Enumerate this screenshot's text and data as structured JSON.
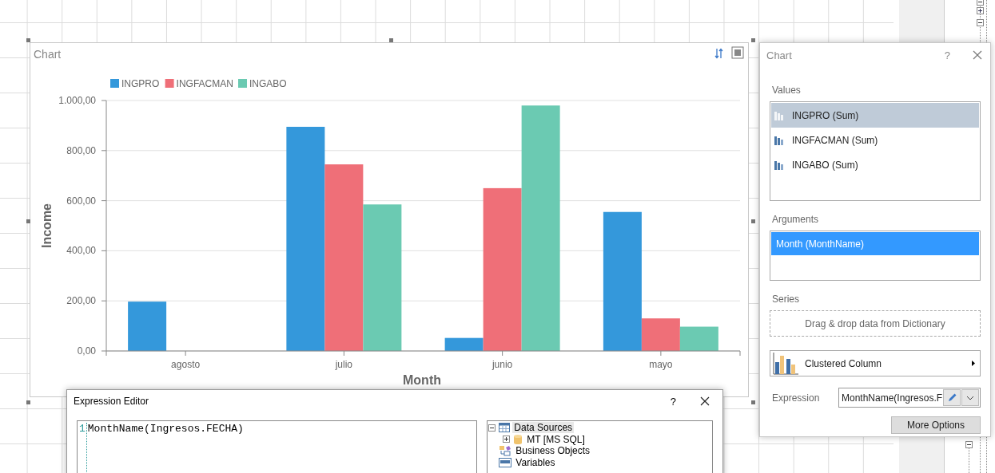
{
  "chart_component": {
    "chart_data": {
      "type": "bar",
      "title": "Chart",
      "grid": true,
      "legend": true,
      "xlabel": "Month",
      "ylabel": "Income",
      "categories": [
        "agosto",
        "julio",
        "junio",
        "mayo"
      ],
      "series": [
        {
          "name": "INGPRO",
          "color": "#3498db",
          "values": [
            197,
            895,
            52,
            555
          ]
        },
        {
          "name": "INGFACMAN",
          "color": "#ef6f78",
          "values": [
            null,
            745,
            650,
            130
          ]
        },
        {
          "name": "INGABO",
          "color": "#6bcab2",
          "values": [
            null,
            585,
            980,
            97
          ]
        }
      ],
      "ylim": [
        0,
        1000
      ],
      "yticks": [
        {
          "value": 0,
          "label": "0,00"
        },
        {
          "value": 200,
          "label": "200,00"
        },
        {
          "value": 400,
          "label": "400,00"
        },
        {
          "value": 600,
          "label": "600,00"
        },
        {
          "value": 800,
          "label": "800,00"
        },
        {
          "value": 1000,
          "label": "1.000,00"
        }
      ]
    }
  },
  "chart_panel": {
    "title": "Chart",
    "help": "?",
    "values_label": "Values",
    "values": [
      {
        "label": "INGPRO (Sum)",
        "selected": true
      },
      {
        "label": "INGFACMAN (Sum)",
        "selected": false
      },
      {
        "label": "INGABO (Sum)",
        "selected": false
      }
    ],
    "arguments_label": "Arguments",
    "arguments": [
      {
        "label": "Month (MonthName)",
        "selected": true
      }
    ],
    "series_label": "Series",
    "series_placeholder": "Drag & drop data from Dictionary",
    "chart_type": "Clustered Column",
    "expression_label": "Expression",
    "expression": "MonthName(Ingresos.F",
    "more_options": "More Options"
  },
  "expression_editor": {
    "title": "Expression Editor",
    "help": "?",
    "line_number": "1",
    "code": "MonthName(Ingresos.FECHA)",
    "tree": [
      {
        "label": "Data Sources",
        "kind": "table",
        "expanded": true,
        "selected": true,
        "children": [
          {
            "label": "MT [MS SQL]",
            "kind": "database",
            "expanded": false,
            "selected": false
          }
        ]
      },
      {
        "label": "Business Objects",
        "kind": "objects",
        "selected": false
      },
      {
        "label": "Variables",
        "kind": "variables",
        "selected": false
      }
    ]
  }
}
